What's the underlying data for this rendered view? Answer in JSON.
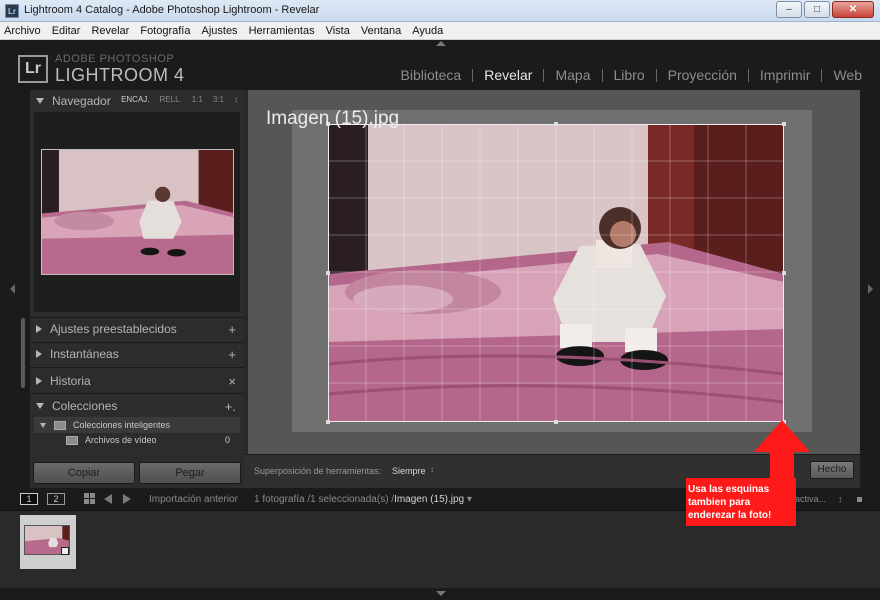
{
  "window": {
    "title": "Lightroom 4 Catalog - Adobe Photoshop Lightroom - Revelar",
    "app_icon": "Lr",
    "minimize": "–",
    "maximize": "□",
    "close": "✕"
  },
  "menu": [
    "Archivo",
    "Editar",
    "Revelar",
    "Fotografía",
    "Ajustes",
    "Herramientas",
    "Vista",
    "Ventana",
    "Ayuda"
  ],
  "brand": {
    "logo": "Lr",
    "line1": "ADOBE PHOTOSHOP",
    "line2": "LIGHTROOM 4"
  },
  "modules": [
    {
      "label": "Biblioteca",
      "active": false
    },
    {
      "label": "Revelar",
      "active": true
    },
    {
      "label": "Mapa",
      "active": false
    },
    {
      "label": "Libro",
      "active": false
    },
    {
      "label": "Proyección",
      "active": false
    },
    {
      "label": "Imprimir",
      "active": false
    },
    {
      "label": "Web",
      "active": false
    }
  ],
  "navigator": {
    "title": "Navegador",
    "zoom": [
      "ENCAJ.",
      "RELL.",
      "1:1",
      "3:1"
    ],
    "zoom_arrows": "↕"
  },
  "left_panels": {
    "presets": "Ajustes preestablecidos",
    "snapshots": "Instantáneas",
    "history": "Historia",
    "collections": "Colecciones",
    "plus": "+",
    "close_x": "×",
    "add_collection": "+."
  },
  "collections": {
    "smart": "Colecciones inteligentes",
    "video_files": "Archivos de vídeo",
    "video_count": "0"
  },
  "buttons": {
    "copy": "Copiar",
    "paste": "Pegar",
    "done": "Hecho"
  },
  "image": {
    "filename": "Imagen (15).jpg"
  },
  "toolbar": {
    "overlay_label": "Superposición de herramientas:",
    "overlay_value": "Siempre",
    "overlay_arrows": "↕"
  },
  "filmstrip": {
    "view1": "1",
    "view2": "2",
    "source": "Importación anterior",
    "count_text": "1 fotografía /1 seleccionada(s) /",
    "current_file": "Imagen (15).jpg",
    "dropdown": "▾",
    "filter_text": "activa...",
    "filter_arrows": "↕"
  },
  "annotation": {
    "text": "Usa las esquinas tambien para enderezar la foto!",
    "color": "#ff1a1a"
  },
  "colors": {
    "accent_red": "#ff1a1a",
    "panel_bg": "#2c2c2c",
    "active_module": "#e6e6e6"
  }
}
